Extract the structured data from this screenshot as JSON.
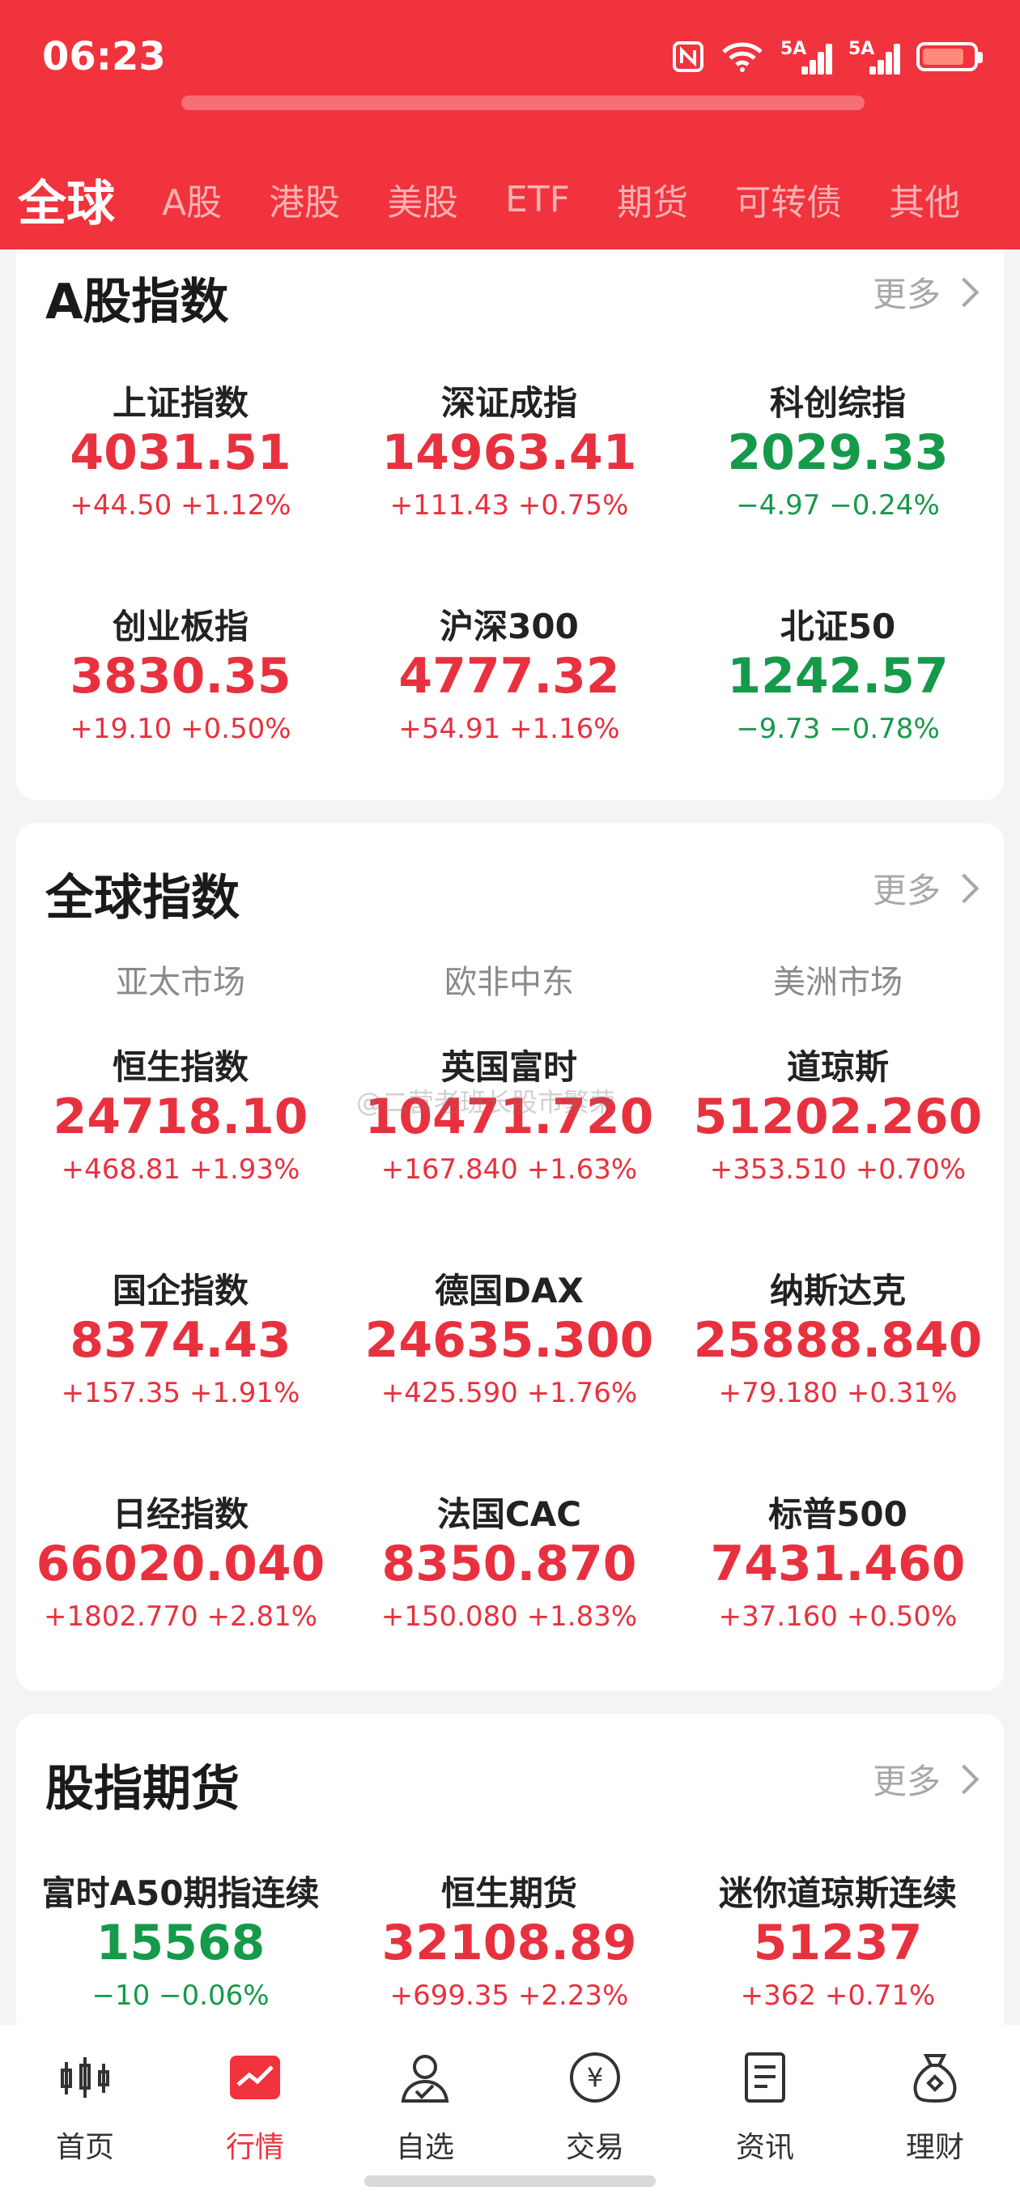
{
  "status_bar": {
    "time": "06:23",
    "sig1": "5A",
    "sig2": "5A"
  },
  "tabs": [
    {
      "label": "全球",
      "active": true
    },
    {
      "label": "A股"
    },
    {
      "label": "港股"
    },
    {
      "label": "美股"
    },
    {
      "label": "ETF"
    },
    {
      "label": "期货"
    },
    {
      "label": "可转债"
    },
    {
      "label": "其他"
    }
  ],
  "a_share": {
    "title": "A股指数",
    "more": "更多",
    "items": [
      {
        "name": "上证指数",
        "value": "4031.51",
        "change": "+44.50 +1.12%",
        "trend": "up"
      },
      {
        "name": "深证成指",
        "value": "14963.41",
        "change": "+111.43 +0.75%",
        "trend": "up"
      },
      {
        "name": "科创综指",
        "value": "2029.33",
        "change": "−4.97 −0.24%",
        "trend": "down"
      },
      {
        "name": "创业板指",
        "value": "3830.35",
        "change": "+19.10 +0.50%",
        "trend": "up"
      },
      {
        "name": "沪深300",
        "value": "4777.32",
        "change": "+54.91 +1.16%",
        "trend": "up"
      },
      {
        "name": "北证50",
        "value": "1242.57",
        "change": "−9.73 −0.78%",
        "trend": "down"
      }
    ]
  },
  "global": {
    "title": "全球指数",
    "more": "更多",
    "regions": [
      "亚太市场",
      "欧非中东",
      "美洲市场"
    ],
    "items": [
      {
        "name": "恒生指数",
        "value": "24718.10",
        "change": "+468.81 +1.93%",
        "trend": "up"
      },
      {
        "name": "英国富时",
        "value": "10471.720",
        "change": "+167.840 +1.63%",
        "trend": "up"
      },
      {
        "name": "道琼斯",
        "value": "51202.260",
        "change": "+353.510 +0.70%",
        "trend": "up"
      },
      {
        "name": "国企指数",
        "value": "8374.43",
        "change": "+157.35 +1.91%",
        "trend": "up"
      },
      {
        "name": "德国DAX",
        "value": "24635.300",
        "change": "+425.590 +1.76%",
        "trend": "up"
      },
      {
        "name": "纳斯达克",
        "value": "25888.840",
        "change": "+79.180 +0.31%",
        "trend": "up"
      },
      {
        "name": "日经指数",
        "value": "66020.040",
        "change": "+1802.770 +2.81%",
        "trend": "up"
      },
      {
        "name": "法国CAC",
        "value": "8350.870",
        "change": "+150.080 +1.83%",
        "trend": "up"
      },
      {
        "name": "标普500",
        "value": "7431.460",
        "change": "+37.160 +0.50%",
        "trend": "up"
      }
    ]
  },
  "futures": {
    "title": "股指期货",
    "more": "更多",
    "items": [
      {
        "name": "富时A50期指连续",
        "value": "15568",
        "change": "−10 −0.06%",
        "trend": "down"
      },
      {
        "name": "恒生期货",
        "value": "32108.89",
        "change": "+699.35 +2.23%",
        "trend": "up"
      },
      {
        "name": "迷你道琼斯连续",
        "value": "51237",
        "change": "+362 +0.71%",
        "trend": "up"
      }
    ]
  },
  "watermark": "@二营老班长股市繁荣",
  "bottom_nav": [
    {
      "label": "首页",
      "icon": "candlestick-icon"
    },
    {
      "label": "行情",
      "icon": "market-chart-icon",
      "active": true
    },
    {
      "label": "自选",
      "icon": "user-check-icon"
    },
    {
      "label": "交易",
      "icon": "yuan-coin-icon"
    },
    {
      "label": "资讯",
      "icon": "news-doc-icon"
    },
    {
      "label": "理财",
      "icon": "money-bag-icon"
    }
  ],
  "colors": {
    "brand": "#f0333c",
    "up": "#e8313f",
    "down": "#159a4a"
  }
}
